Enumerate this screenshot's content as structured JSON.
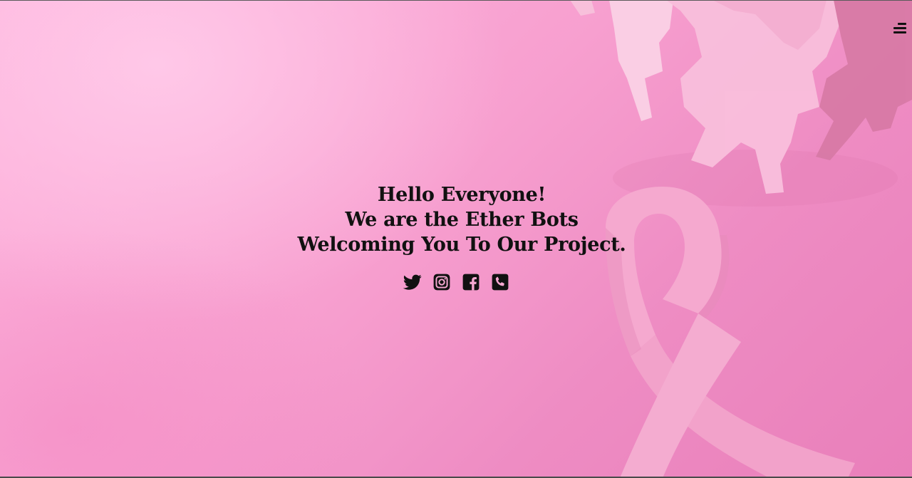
{
  "hero": {
    "greeting_lines": [
      "Hello Everyone!",
      "We are the Ether Bots",
      "Welcoming You To Our Project."
    ],
    "background_image": "pink-ribbon-paper-people",
    "colors": {
      "background": "#f7a3d2",
      "text": "#111111",
      "ribbon": "#f3a6cd"
    }
  },
  "nav": {
    "menu_icon": "hamburger-menu-icon"
  },
  "social_links": [
    {
      "name": "twitter",
      "icon": "twitter-icon"
    },
    {
      "name": "instagram",
      "icon": "instagram-icon"
    },
    {
      "name": "facebook",
      "icon": "facebook-icon"
    },
    {
      "name": "phone",
      "icon": "phone-icon"
    }
  ]
}
